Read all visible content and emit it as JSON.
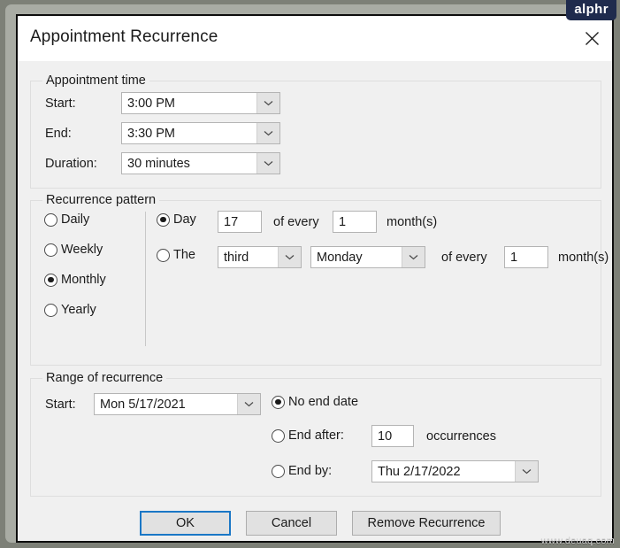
{
  "window": {
    "title": "Appointment Recurrence",
    "close_icon": "close-icon"
  },
  "appointment_time": {
    "legend": "Appointment time",
    "start_label": "Start:",
    "start_value": "3:00 PM",
    "end_label": "End:",
    "end_value": "3:30 PM",
    "duration_label": "Duration:",
    "duration_value": "30 minutes"
  },
  "recurrence_pattern": {
    "legend": "Recurrence pattern",
    "frequencies": [
      {
        "label": "Daily",
        "selected": false
      },
      {
        "label": "Weekly",
        "selected": false
      },
      {
        "label": "Monthly",
        "selected": true
      },
      {
        "label": "Yearly",
        "selected": false
      }
    ],
    "day_option": {
      "label": "Day",
      "selected": true,
      "day_value": "17",
      "of_every_label": "of every",
      "interval_value": "1",
      "unit_label": "month(s)"
    },
    "the_option": {
      "label": "The",
      "selected": false,
      "ordinal_value": "third",
      "weekday_value": "Monday",
      "of_every_label": "of every",
      "interval_value": "1",
      "unit_label": "month(s)"
    }
  },
  "range_of_recurrence": {
    "legend": "Range of recurrence",
    "start_label": "Start:",
    "start_value": "Mon 5/17/2021",
    "no_end_date": {
      "label": "No end date",
      "selected": true
    },
    "end_after": {
      "label": "End after:",
      "selected": false,
      "value": "10",
      "unit_label": "occurrences"
    },
    "end_by": {
      "label": "End by:",
      "selected": false,
      "value": "Thu 2/17/2022"
    }
  },
  "buttons": {
    "ok": "OK",
    "cancel": "Cancel",
    "remove": "Remove Recurrence"
  },
  "watermarks": {
    "brand": "alphr",
    "site": "www.deuaq.com"
  },
  "colors": {
    "accent": "#1a77c6",
    "dialog_bg": "#f0f0f0",
    "titlebar_bg": "#ffffff",
    "badge_bg": "#1f2b4d"
  }
}
